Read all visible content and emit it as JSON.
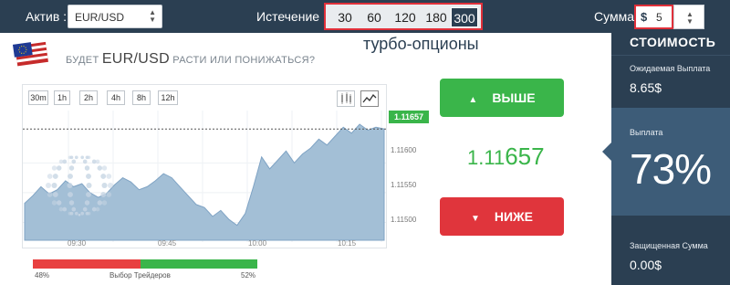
{
  "topbar": {
    "asset_label": "Актив :",
    "asset_value": "EUR/USD",
    "expiry_label": "Истечение :",
    "expiry_options": [
      "30",
      "60",
      "120",
      "180",
      "300"
    ],
    "expiry_selected": "300",
    "amount_label": "Сумма",
    "currency_sign": "$",
    "amount_value": "5"
  },
  "annotation": {
    "turbo_label": "турбо-опционы"
  },
  "question": {
    "prefix": "БУДЕТ",
    "pair": "EUR/USD",
    "suffix": "РАСТИ ИЛИ ПОНИЖАТЬСЯ?"
  },
  "chart": {
    "timeframes": [
      "30m",
      "1h",
      "2h",
      "4h",
      "8h",
      "12h"
    ],
    "tool_icons": [
      "candlestick-chart-icon",
      "line-chart-icon"
    ],
    "current_price": "1.11657",
    "y_ticks": [
      "1.11600",
      "1.11550",
      "1.11500"
    ],
    "x_ticks": [
      "09:30",
      "09:45",
      "10:00",
      "10:15"
    ],
    "area_color": "#a3bfd6",
    "line_color": "#7fa3c4"
  },
  "chart_data": {
    "type": "area",
    "title": "",
    "xlabel": "",
    "ylabel": "",
    "x_ticks": [
      "09:30",
      "09:45",
      "10:00",
      "10:15"
    ],
    "y_ticks": [
      1.116,
      1.1155,
      1.115
    ],
    "ylim": [
      1.1147,
      1.11685
    ],
    "current_value": 1.11657,
    "series": [
      {
        "values": [
          1.11532,
          1.11545,
          1.1156,
          1.11548,
          1.11555,
          1.1157,
          1.1156,
          1.11565,
          1.1155,
          1.11542,
          1.11548,
          1.11563,
          1.11575,
          1.11568,
          1.11555,
          1.1156,
          1.1157,
          1.11582,
          1.11575,
          1.1156,
          1.11545,
          1.1153,
          1.11525,
          1.1151,
          1.1152,
          1.11505,
          1.11495,
          1.11515,
          1.1156,
          1.1161,
          1.1159,
          1.11605,
          1.1162,
          1.116,
          1.11615,
          1.11625,
          1.1164,
          1.1163,
          1.11645,
          1.1166,
          1.1165,
          1.11665,
          1.11655,
          1.1166,
          1.11657
        ]
      }
    ],
    "grid": true
  },
  "traders": {
    "left_pct_label": "48%",
    "title": "Выбор Трейдеров",
    "right_pct_label": "52%",
    "down_fraction": 0.48,
    "up_fraction": 0.52
  },
  "actions": {
    "up_label": "ВЫШЕ",
    "down_label": "НИЖЕ",
    "price_prefix": "1.11",
    "price_suffix": "657"
  },
  "panel": {
    "title": "СТОИМОСТЬ",
    "expected_label": "Ожидаемая Выплата",
    "expected_value": "8.65$",
    "payout_label": "Выплата",
    "payout_value": "73%",
    "protected_label": "Защищенная Сумма",
    "protected_value": "0.00$"
  },
  "colors": {
    "brand_dark": "#2b3f52",
    "up_green": "#3ab54a",
    "down_red": "#e0353c",
    "highlight_red": "#e0303a"
  }
}
